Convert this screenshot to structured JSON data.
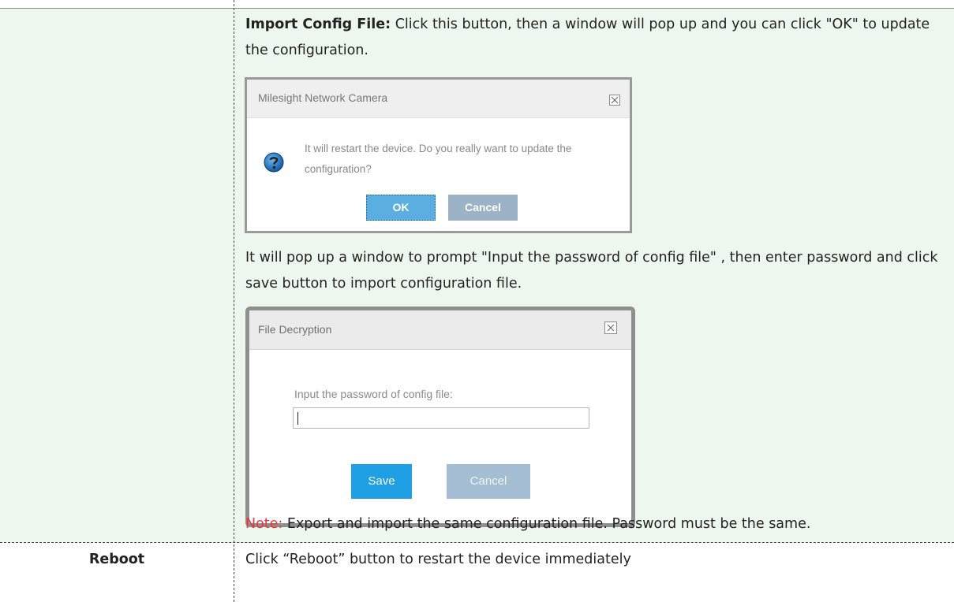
{
  "row1": {
    "import_title": "Import Config File:",
    "import_desc": " Click this button, then a window will pop up and you can click \"OK\" to update the configuration.",
    "prompt_text": "It will pop up a window to prompt \"Input the password of config file\" , then enter password and click save button to import configuration file.",
    "note_label": "Note:",
    "note_text": " Export and import the same configuration file. Password must be the same."
  },
  "dialog_confirm": {
    "title": "Milesight Network Camera",
    "message": "It will restart the device. Do you really want to update the configuration?",
    "ok_label": "OK",
    "cancel_label": "Cancel",
    "icon": "question-icon"
  },
  "dialog_decrypt": {
    "title": "File Decryption",
    "input_label": "Input the password of config file:",
    "input_value": "",
    "save_label": "Save",
    "cancel_label": "Cancel"
  },
  "row2": {
    "label": "Reboot",
    "text": "Click “Reboot” button to restart the device immediately"
  },
  "colors": {
    "row_bg": "#eef7ee",
    "note": "#e8353b",
    "ok_button": "#5aaee0",
    "save_button": "#1fa0e4",
    "cancel_button": "#a4bdd3"
  }
}
